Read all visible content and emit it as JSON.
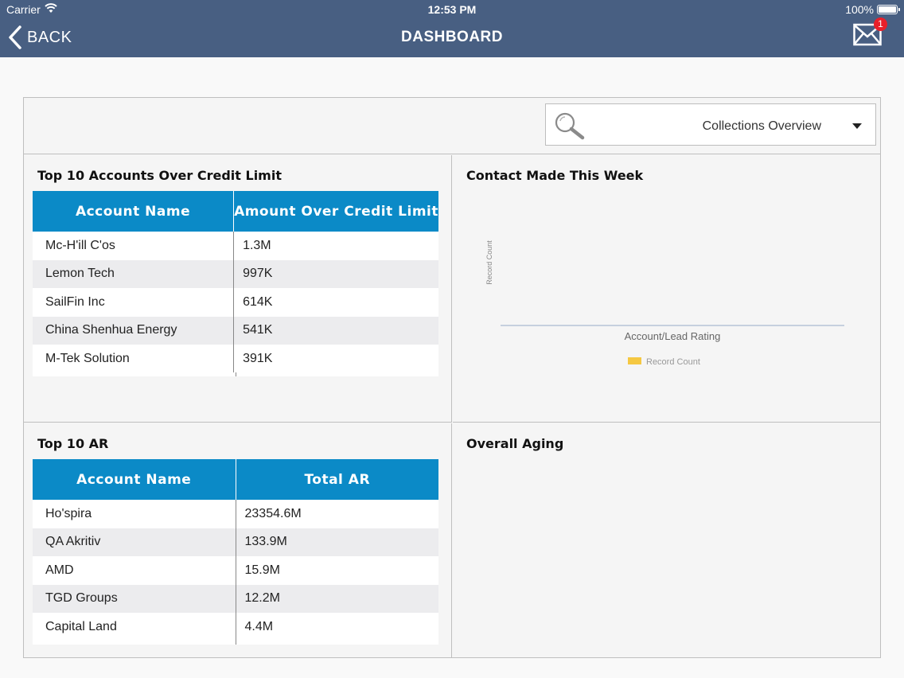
{
  "status_bar": {
    "carrier": "Carrier",
    "time": "12:53 PM",
    "battery": "100%"
  },
  "nav": {
    "back_label": "BACK",
    "title": "DASHBOARD",
    "mail_badge": "1"
  },
  "toolbar": {
    "dashboard_select": "Collections Overview"
  },
  "panels": {
    "credit_limit": {
      "title": "Top 10 Accounts Over Credit Limit",
      "headers": [
        "Account Name",
        "Amount Over Credit Limit"
      ],
      "rows": [
        [
          "Mc-H'ill C'os",
          "1.3M"
        ],
        [
          "Lemon Tech",
          "997K"
        ],
        [
          "SailFin Inc",
          "614K"
        ],
        [
          "China Shenhua Energy",
          "541K"
        ],
        [
          "M-Tek Solution",
          "391K"
        ]
      ]
    },
    "contact": {
      "title": "Contact Made This Week"
    },
    "top_ar": {
      "title": "Top 10 AR",
      "headers": [
        "Account Name",
        "Total AR"
      ],
      "rows": [
        [
          "Ho'spira",
          "23354.6M"
        ],
        [
          "QA Akritiv",
          "133.9M"
        ],
        [
          "AMD",
          "15.9M"
        ],
        [
          "TGD Groups",
          "12.2M"
        ],
        [
          "Capital Land",
          "4.4M"
        ]
      ]
    },
    "aging": {
      "title": "Overall Aging"
    }
  },
  "chart_data": {
    "type": "bar",
    "categories": [],
    "series": [
      {
        "name": "Record Count",
        "values": []
      }
    ],
    "xlabel": "Account/Lead Rating",
    "ylabel": "Record Count",
    "legend": "bottom",
    "colors": {
      "Record Count": "#f5c842"
    }
  }
}
